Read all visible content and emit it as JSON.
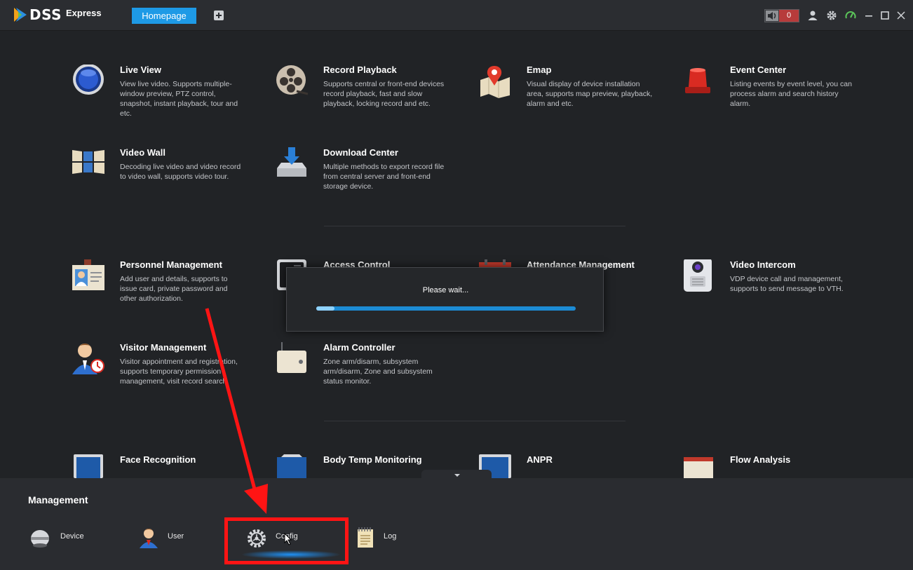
{
  "app": {
    "logo_text": "DSS",
    "logo_sub": "Express",
    "tabs": [
      {
        "label": "Homepage"
      }
    ],
    "alarm_count": "0"
  },
  "modules": [
    {
      "title": "Live View",
      "desc": "View live video. Supports multiple-window preview, PTZ control, snapshot, instant playback, tour and etc.",
      "icon": "live-view-icon"
    },
    {
      "title": "Record Playback",
      "desc": "Supports central or front-end devices record playback, fast and slow playback, locking record and etc.",
      "icon": "film-reel-icon"
    },
    {
      "title": "Emap",
      "desc": "Visual display of device installation area, supports map preview, playback, alarm and etc.",
      "icon": "map-pin-icon"
    },
    {
      "title": "Event Center",
      "desc": "Listing events by event level, you can process alarm and search history alarm.",
      "icon": "alarm-light-icon"
    },
    {
      "title": "Video Wall",
      "desc": "Decoding live video and video record to video wall, supports video tour.",
      "icon": "video-wall-icon"
    },
    {
      "title": "Download Center",
      "desc": "Multiple methods to export record file from central server and front-end storage device.",
      "icon": "download-icon"
    },
    {
      "title": "Personnel Management",
      "desc": "Add user and details, supports to issue card, private password and other authorization.",
      "icon": "id-badge-icon"
    },
    {
      "title": "Access Control",
      "desc": "",
      "icon": "access-panel-icon"
    },
    {
      "title": "Attendance Management",
      "desc": "",
      "icon": "calendar-icon"
    },
    {
      "title": "Video Intercom",
      "desc": "VDP device call and management, supports to send message to VTH.",
      "icon": "intercom-icon"
    },
    {
      "title": "Visitor Management",
      "desc": "Visitor appointment and registration, supports temporary permission management, visit record search.",
      "icon": "visitor-icon"
    },
    {
      "title": "Alarm Controller",
      "desc": "Zone arm/disarm, subsystem arm/disarm, Zone and subsystem status monitor.",
      "icon": "alarm-controller-icon"
    },
    {
      "title": "Face Recognition",
      "desc": "",
      "icon": "face-recognition-icon"
    },
    {
      "title": "Body Temp Monitoring",
      "desc": "",
      "icon": "body-temp-icon"
    },
    {
      "title": "ANPR",
      "desc": "",
      "icon": "anpr-icon"
    },
    {
      "title": "Flow Analysis",
      "desc": "",
      "icon": "flow-analysis-icon"
    }
  ],
  "dialog": {
    "message": "Please wait...",
    "progress": 0.07
  },
  "management": {
    "title": "Management",
    "items": [
      {
        "label": "Device",
        "icon": "device-icon"
      },
      {
        "label": "User",
        "icon": "user-icon"
      },
      {
        "label": "Config",
        "icon": "gear-icon"
      },
      {
        "label": "Log",
        "icon": "notepad-icon"
      }
    ]
  },
  "colors": {
    "accent": "#1e9ae6",
    "highlight": "#ff1414",
    "background": "#212326"
  }
}
